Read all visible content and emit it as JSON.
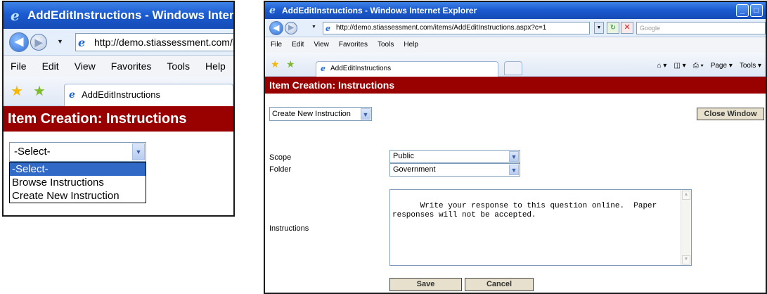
{
  "left_window": {
    "title": "AddEditInstructions - Windows Internet",
    "url": "http://demo.stiassessment.com/it",
    "menu": [
      "File",
      "Edit",
      "View",
      "Favorites",
      "Tools",
      "Help"
    ],
    "tab_label": "AddEditInstructions",
    "page_header": "Item Creation: Instructions",
    "select_value": "-Select-",
    "dropdown_options": [
      "-Select-",
      "Browse Instructions",
      "Create New Instruction"
    ]
  },
  "right_window": {
    "title": "AddEditInstructions - Windows Internet Explorer",
    "url": "http://demo.stiassessment.com/items/AddEditInstructions.aspx?c=1",
    "search_placeholder": "Google",
    "menu": [
      "File",
      "Edit",
      "View",
      "Favorites",
      "Tools",
      "Help"
    ],
    "tab_label": "AddEditInstructions",
    "commands": [
      "Page ▾",
      "Tools ▾"
    ],
    "page_header": "Item Creation: Instructions",
    "mode_select_value": "Create New Instruction",
    "close_button": "Close Window",
    "scope_label": "Scope",
    "scope_value": "Public",
    "folder_label": "Folder",
    "folder_value": "Government",
    "instructions_label": "Instructions",
    "instructions_text": "Write your response to this question online.  Paper\nresponses will not be accepted.",
    "save_button": "Save",
    "cancel_button": "Cancel"
  }
}
